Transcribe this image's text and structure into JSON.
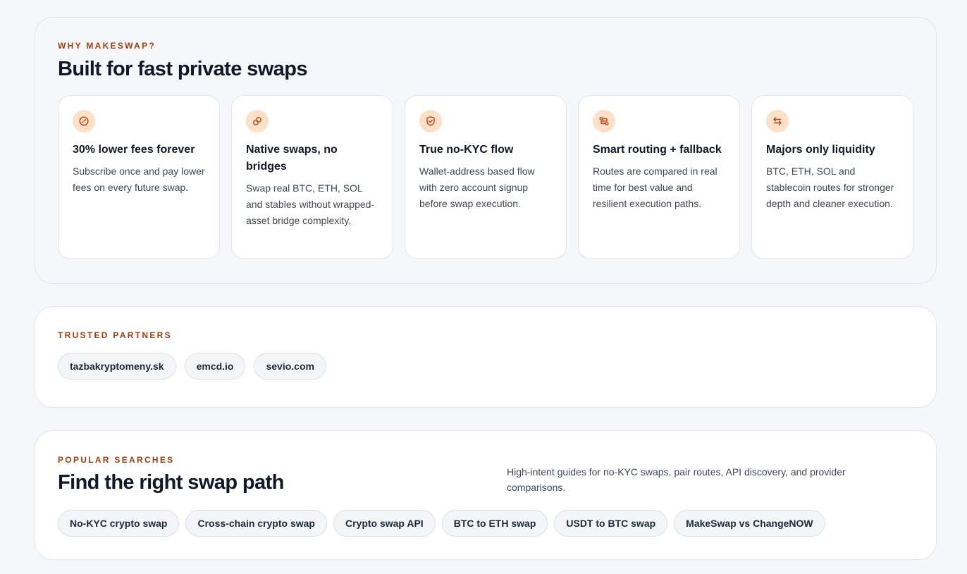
{
  "why": {
    "eyebrow": "WHY MAKESWAP?",
    "heading": "Built for fast private swaps",
    "cards": [
      {
        "icon": "gauge-icon",
        "title": "30% lower fees forever",
        "desc": "Subscribe once and pay lower fees on every future swap."
      },
      {
        "icon": "link-icon",
        "title": "Native swaps, no bridges",
        "desc": "Swap real BTC, ETH, SOL and stables without wrapped-asset bridge complexity."
      },
      {
        "icon": "shield-check-icon",
        "title": "True no-KYC flow",
        "desc": "Wallet-address based flow with zero account signup before swap execution."
      },
      {
        "icon": "route-icon",
        "title": "Smart routing + fallback",
        "desc": "Routes are compared in real time for best value and resilient execution paths."
      },
      {
        "icon": "swap-arrows-icon",
        "title": "Majors only liquidity",
        "desc": "BTC, ETH, SOL and stablecoin routes for stronger depth and cleaner execution."
      }
    ]
  },
  "partners": {
    "eyebrow": "TRUSTED PARTNERS",
    "items": [
      "tazbakryptomeny.sk",
      "emcd.io",
      "sevio.com"
    ]
  },
  "popular": {
    "eyebrow": "POPULAR SEARCHES",
    "heading": "Find the right swap path",
    "note": "High-intent guides for no-KYC swaps, pair routes, API discovery, and provider comparisons.",
    "links": [
      "No-KYC crypto swap",
      "Cross-chain crypto swap",
      "Crypto swap API",
      "BTC to ETH swap",
      "USDT to BTC swap",
      "MakeSwap vs ChangeNOW"
    ]
  },
  "colors": {
    "accent": "#a23d0c",
    "icon_bg": "#fde0c8",
    "icon_stroke": "#c2410c",
    "page_bg": "#f5f7fb"
  }
}
